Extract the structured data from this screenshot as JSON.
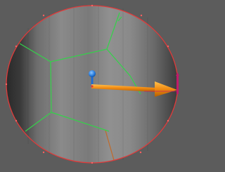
{
  "viewport": {
    "background_color": "#5c5c5c",
    "object": {
      "type": "mesh-disc",
      "boundary_color": "#e03a3a",
      "edge_color": "#34d24a",
      "shade_dark": "#2a2a2a",
      "shade_mid": "#6a6a6a",
      "shade_light": "#9a9a9a"
    },
    "gizmo": {
      "type": "translate",
      "x_axis_color": "#f08a12",
      "z_axis_color": "#2a7fe0",
      "end_marker_color": "#c01a6a",
      "icons": [
        "translate-gizmo-icon",
        "arrow-x-icon",
        "handle-z-icon"
      ]
    }
  }
}
